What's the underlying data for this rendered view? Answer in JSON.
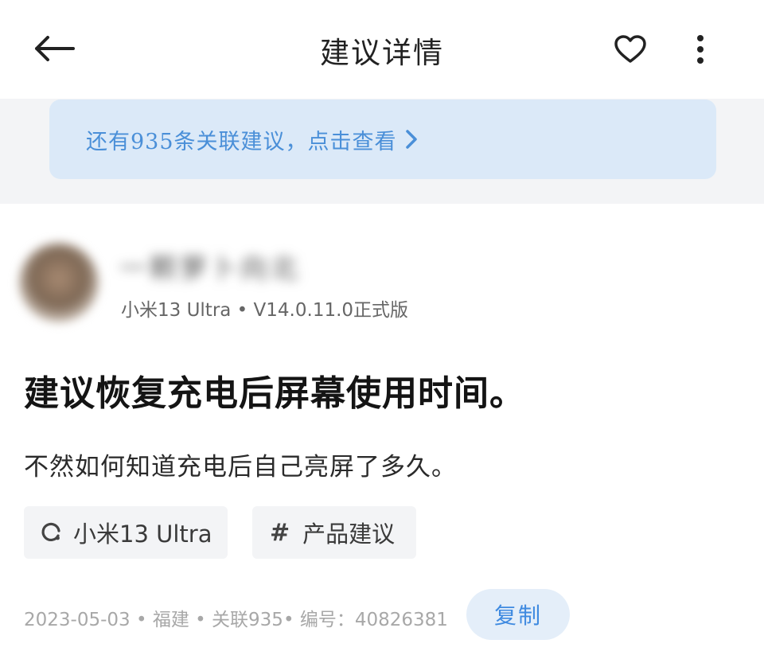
{
  "header": {
    "title": "建议详情",
    "back_icon": "arrow-left-icon",
    "favorite_icon": "heart-icon",
    "more_icon": "more-vertical-icon"
  },
  "banner": {
    "text": "还有935条关联建议，点击查看",
    "chevron_icon": "chevron-right-icon",
    "color": "#4a8fd8"
  },
  "author": {
    "name": "一颗萝卜向北",
    "device_info": "小米13 Ultra • V14.0.11.0正式版"
  },
  "post": {
    "title": "建议恢复充电后屏幕使用时间。",
    "body": "不然如何知道充电后自己亮屏了多久。"
  },
  "tags": {
    "device": "小米13 Ultra",
    "category": "产品建议",
    "device_icon": "loading-circle-icon",
    "category_icon": "hash-icon",
    "hash_symbol": "#"
  },
  "meta": {
    "text": "2023-05-03 • 福建 • 关联935• 编号：40826381"
  },
  "copy_button": {
    "label": "复制",
    "color": "#3f8ae0"
  }
}
